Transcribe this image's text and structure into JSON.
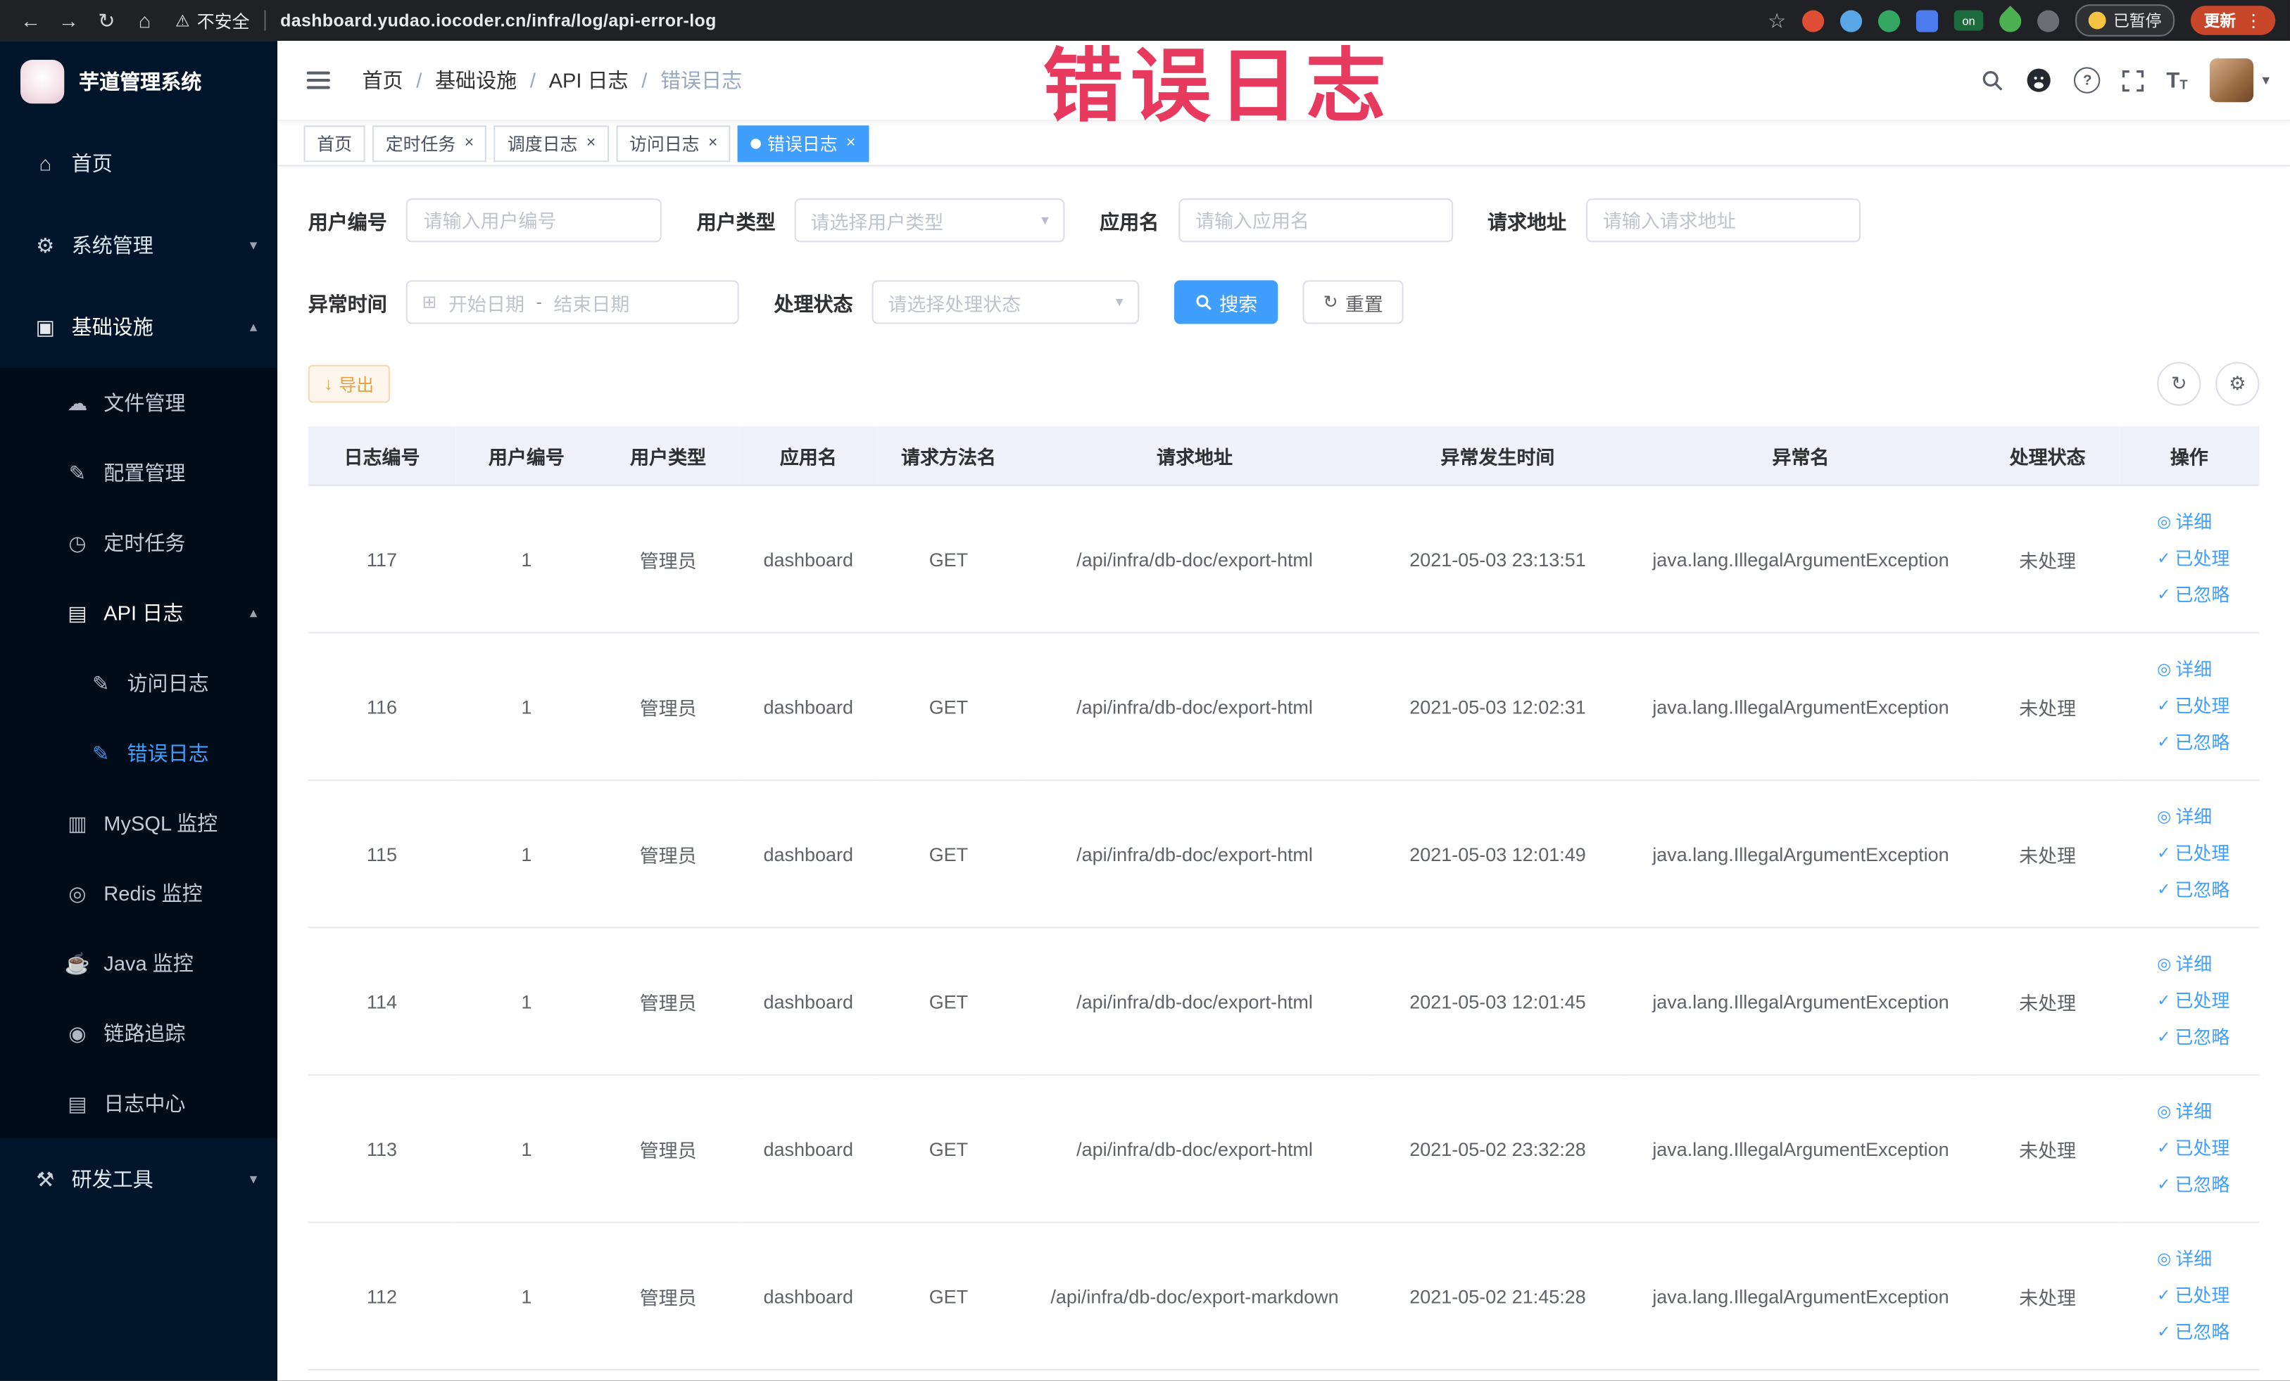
{
  "watermark": {
    "text": "错误日志"
  },
  "browser": {
    "security_label": "不安全",
    "url": "dashboard.yudao.iocoder.cn/infra/log/api-error-log",
    "paused_label": "已暂停",
    "update_label": "更新",
    "extension_badge": "on"
  },
  "icons": {
    "back": "←",
    "forward": "→",
    "reload": "↻",
    "home": "⌂",
    "warning": "⚠",
    "star": "☆",
    "kebab": "⋮",
    "caret_down": "▾",
    "caret_up": "▴",
    "question": "?",
    "font_letter": "T",
    "menu_home": "⌂",
    "menu_system": "⚙",
    "menu_infra": "▣",
    "menu_file": "☁",
    "menu_config": "✎",
    "menu_job": "◷",
    "menu_api_log": "▤",
    "menu_access_log": "✎",
    "menu_error_log": "✎",
    "menu_mysql": "▥",
    "menu_redis": "◎",
    "menu_java": "☕",
    "menu_trace": "◉",
    "menu_log_center": "▤",
    "menu_dev": "⚒",
    "calendar": "⊞",
    "refresh": "↻",
    "gear": "⚙",
    "download": "↓",
    "eye": "◎",
    "check": "✓",
    "close": "×"
  },
  "sidebar": {
    "logo_title": "芋道管理系统",
    "items": [
      "首页",
      "系统管理",
      "基础设施",
      "文件管理",
      "配置管理",
      "定时任务",
      "API 日志",
      "访问日志",
      "错误日志",
      "MySQL 监控",
      "Redis 监控",
      "Java 监控",
      "链路追踪",
      "日志中心",
      "研发工具"
    ]
  },
  "breadcrumb": {
    "separator": "/",
    "items": [
      "首页",
      "基础设施",
      "API 日志",
      "错误日志"
    ]
  },
  "tabs": [
    {
      "label": "首页"
    },
    {
      "label": "定时任务"
    },
    {
      "label": "调度日志"
    },
    {
      "label": "访问日志"
    },
    {
      "label": "错误日志"
    }
  ],
  "filters": {
    "user_id_label": "用户编号",
    "user_id_placeholder": "请输入用户编号",
    "user_type_label": "用户类型",
    "user_type_placeholder": "请选择用户类型",
    "app_name_label": "应用名",
    "app_name_placeholder": "请输入应用名",
    "request_url_label": "请求地址",
    "request_url_placeholder": "请输入请求地址",
    "exception_time_label": "异常时间",
    "date_start_placeholder": "开始日期",
    "date_separator": "-",
    "date_end_placeholder": "结束日期",
    "process_status_label": "处理状态",
    "process_status_placeholder": "请选择处理状态",
    "search_label": "搜索",
    "reset_label": "重置"
  },
  "toolbar": {
    "export_label": "导出"
  },
  "table": {
    "columns": [
      "日志编号",
      "用户编号",
      "用户类型",
      "应用名",
      "请求方法名",
      "请求地址",
      "异常发生时间",
      "异常名",
      "处理状态",
      "操作"
    ],
    "actions": {
      "detail": "详细",
      "processed": "已处理",
      "ignored": "已忽略"
    },
    "rows": [
      {
        "id": "117",
        "user_id": "1",
        "user_type": "管理员",
        "app": "dashboard",
        "method": "GET",
        "url": "/api/infra/db-doc/export-html",
        "time": "2021-05-03 23:13:51",
        "exception": "java.lang.IllegalArgumentException",
        "status": "未处理"
      },
      {
        "id": "116",
        "user_id": "1",
        "user_type": "管理员",
        "app": "dashboard",
        "method": "GET",
        "url": "/api/infra/db-doc/export-html",
        "time": "2021-05-03 12:02:31",
        "exception": "java.lang.IllegalArgumentException",
        "status": "未处理"
      },
      {
        "id": "115",
        "user_id": "1",
        "user_type": "管理员",
        "app": "dashboard",
        "method": "GET",
        "url": "/api/infra/db-doc/export-html",
        "time": "2021-05-03 12:01:49",
        "exception": "java.lang.IllegalArgumentException",
        "status": "未处理"
      },
      {
        "id": "114",
        "user_id": "1",
        "user_type": "管理员",
        "app": "dashboard",
        "method": "GET",
        "url": "/api/infra/db-doc/export-html",
        "time": "2021-05-03 12:01:45",
        "exception": "java.lang.IllegalArgumentException",
        "status": "未处理"
      },
      {
        "id": "113",
        "user_id": "1",
        "user_type": "管理员",
        "app": "dashboard",
        "method": "GET",
        "url": "/api/infra/db-doc/export-html",
        "time": "2021-05-02 23:32:28",
        "exception": "java.lang.IllegalArgumentException",
        "status": "未处理"
      },
      {
        "id": "112",
        "user_id": "1",
        "user_type": "管理员",
        "app": "dashboard",
        "method": "GET",
        "url": "/api/infra/db-doc/export-markdown",
        "time": "2021-05-02 21:45:28",
        "exception": "java.lang.IllegalArgumentException",
        "status": "未处理"
      }
    ]
  }
}
